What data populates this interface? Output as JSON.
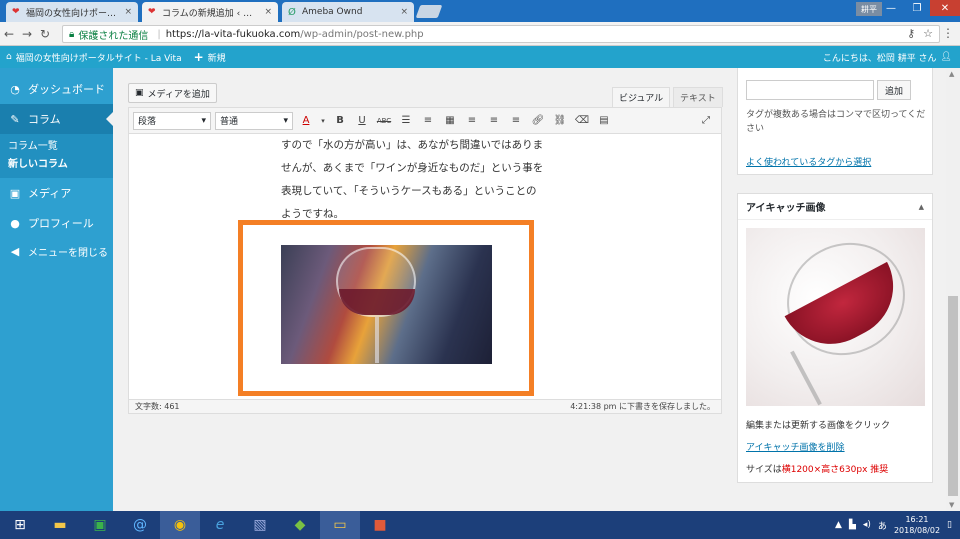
{
  "browser": {
    "tabs": [
      {
        "label": "福岡の女性向けポータルサイ",
        "active": false
      },
      {
        "label": "コラムの新規追加 ‹ 福岡の",
        "active": true
      },
      {
        "label": "Ameba Ownd",
        "active": false
      }
    ],
    "tab_close": "×",
    "user_badge": "耕平",
    "window_buttons": {
      "minimize": "—",
      "restore": "❐",
      "close": "✕"
    },
    "secure_label": "保護された通信",
    "url_host": "https://la-vita-fukuoka.com",
    "url_path": "/wp-admin/post-new.php"
  },
  "adminbar": {
    "site_name": "福岡の女性向けポータルサイト - La Vita",
    "new_label": "新規",
    "greeting": "こんにちは、松岡 耕平 さん"
  },
  "sidebar": {
    "dashboard": "ダッシュボード",
    "column": "コラム",
    "column_list": "コラム一覧",
    "new_column": "新しいコラム",
    "media": "メディア",
    "profile": "プロフィール",
    "collapse": "メニューを閉じる"
  },
  "editor": {
    "add_media": "メディアを追加",
    "visual_tab": "ビジュアル",
    "text_tab": "テキスト",
    "format_select": "段落",
    "font_select": "普通",
    "paragraph_lines": [
      "すので「水の方が高い」は、あながち間違いではありま",
      "せんが、あくまで「ワインが身近なものだ」という事を",
      "表現していて、「そういうケースもある」ということの",
      "ようですね。"
    ],
    "word_count": "文字数: 461",
    "save_status": "4:21:38 pm に下書きを保存しました。"
  },
  "tags": {
    "add_button": "追加",
    "hint": "タグが複数ある場合はコンマで区切ってください",
    "choose_link": "よく使われているタグから選択"
  },
  "featured_image": {
    "title": "アイキャッチ画像",
    "caption": "編集または更新する画像をクリック",
    "remove_link": "アイキャッチ画像を削除",
    "size_prefix": "サイズは",
    "size_value": "横1200×高さ630px 推奨"
  },
  "taskbar": {
    "time": "16:21",
    "date": "2018/08/02",
    "ime": "あ"
  },
  "colors": {
    "admin_blue": "#23a3cc",
    "highlight_orange": "#f47f25",
    "link_blue": "#0073aa"
  }
}
